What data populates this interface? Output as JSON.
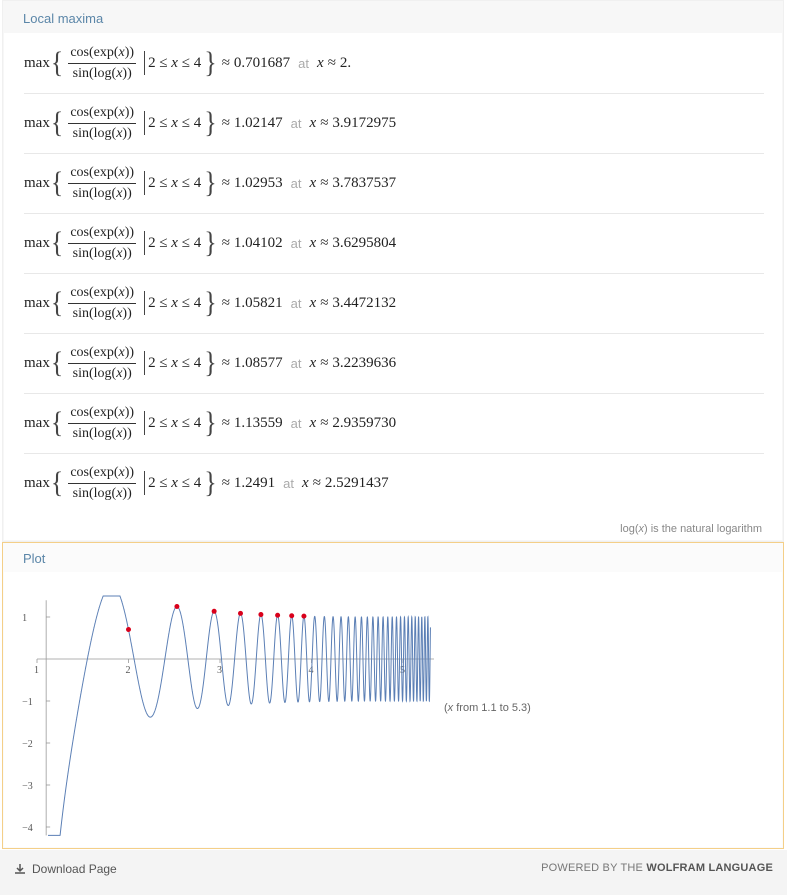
{
  "maxima": {
    "title": "Local maxima",
    "function": {
      "prefix": "max",
      "numerator": "cos(exp(",
      "numerator_var": "x",
      "numerator_close": "))",
      "denominator": "sin(log(",
      "denominator_var": "x",
      "denominator_close": "))",
      "condition": "2 ≤ ",
      "condition_var": "x",
      "condition_tail": " ≤ 4"
    },
    "approx": "≈",
    "at_label": "at",
    "x_var": "x",
    "rows": [
      {
        "value": "0.701687",
        "x": "2."
      },
      {
        "value": "1.02147",
        "x": "3.9172975"
      },
      {
        "value": "1.02953",
        "x": "3.7837537"
      },
      {
        "value": "1.04102",
        "x": "3.6295804"
      },
      {
        "value": "1.05821",
        "x": "3.4472132"
      },
      {
        "value": "1.08577",
        "x": "3.2239636"
      },
      {
        "value": "1.13559",
        "x": "2.9359730"
      },
      {
        "value": "1.2491",
        "x": "2.5291437"
      }
    ],
    "note_pre": "log(",
    "note_var": "x",
    "note_post": ") is the natural logarithm"
  },
  "plot": {
    "title": "Plot",
    "range_note_pre": "(",
    "range_note_var": "x",
    "range_note_post": " from 1.1 to 5.3)",
    "line_color": "#5b7fb5",
    "point_color": "#d9001b"
  },
  "chart_data": {
    "type": "line",
    "function": "cos(exp(x))/sin(log(x))",
    "xlim": [
      1.1,
      5.3
    ],
    "ylim": [
      -4.2,
      1.5
    ],
    "x_ticks": [
      "1",
      "2",
      "3",
      "4",
      "5"
    ],
    "y_ticks": [
      "1",
      "−1",
      "−2",
      "−3",
      "−4"
    ],
    "maxima_points": [
      {
        "x": 2.0,
        "y": 0.701687
      },
      {
        "x": 2.5291437,
        "y": 1.2491
      },
      {
        "x": 2.935973,
        "y": 1.13559
      },
      {
        "x": 3.2239636,
        "y": 1.08577
      },
      {
        "x": 3.4472132,
        "y": 1.05821
      },
      {
        "x": 3.6295804,
        "y": 1.04102
      },
      {
        "x": 3.7837537,
        "y": 1.02953
      },
      {
        "x": 3.9172975,
        "y": 1.02147
      }
    ],
    "grid": false
  },
  "footer": {
    "download_label": "Download Page",
    "powered_pre": "POWERED BY THE ",
    "powered_brand": "WOLFRAM LANGUAGE"
  }
}
